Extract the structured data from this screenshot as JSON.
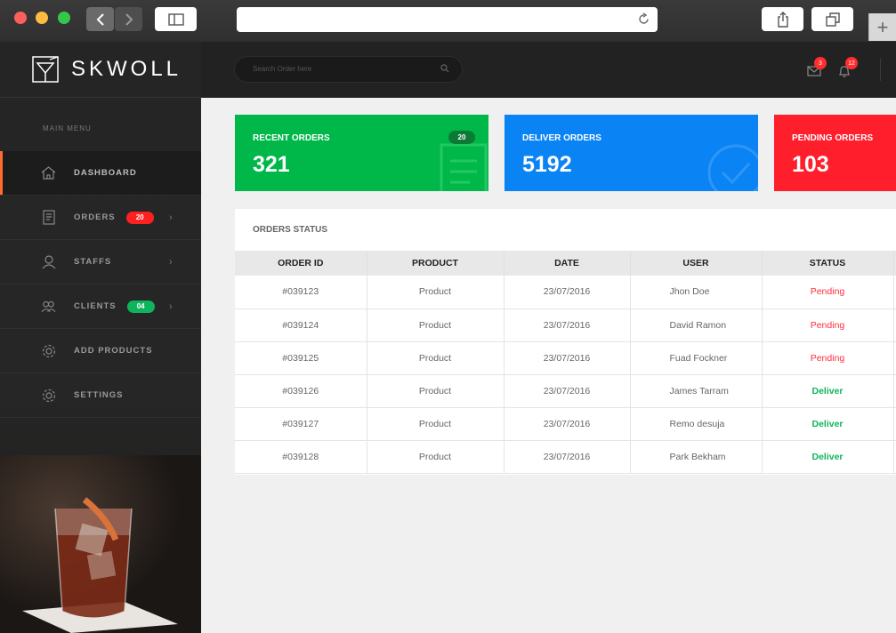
{
  "browser": {
    "url": ""
  },
  "brand": {
    "name": "SKWOLL"
  },
  "sidebar": {
    "menu_title": "MAIN MENU",
    "items": [
      {
        "label": "DASHBOARD",
        "icon": "home-icon",
        "badge": null
      },
      {
        "label": "ORDERS",
        "icon": "orders-icon",
        "badge": "20",
        "badge_color": "#ff2020"
      },
      {
        "label": "STAFFS",
        "icon": "user-icon",
        "badge": null
      },
      {
        "label": "CLIENTS",
        "icon": "clients-icon",
        "badge": "04",
        "badge_color": "#0eb45c"
      },
      {
        "label": "ADD PRODUCTS",
        "icon": "gear-icon",
        "badge": null
      },
      {
        "label": "SETTINGS",
        "icon": "gear-icon",
        "badge": null
      }
    ]
  },
  "topbar": {
    "search_placeholder": "Search Order here",
    "mail_count": "3",
    "bell_count": "12"
  },
  "cards": [
    {
      "label": "RECENT ORDERS",
      "value": "321",
      "badge": "20",
      "color": "#00b74a"
    },
    {
      "label": "DELIVER ORDERS",
      "value": "5192",
      "color": "#0a84f4"
    },
    {
      "label": "PENDING ORDERS",
      "value": "103",
      "color": "#ff1e2b"
    }
  ],
  "orders": {
    "title": "ORDERS STATUS",
    "columns": [
      "ORDER ID",
      "PRODUCT",
      "DATE",
      "USER",
      "STATUS"
    ],
    "rows": [
      {
        "id": "#039123",
        "product": "Product",
        "date": "23/07/2016",
        "user": "Jhon Doe",
        "status": "Pending"
      },
      {
        "id": "#039124",
        "product": "Product",
        "date": "23/07/2016",
        "user": "David Ramon",
        "status": "Pending"
      },
      {
        "id": "#039125",
        "product": "Product",
        "date": "23/07/2016",
        "user": "Fuad Fockner",
        "status": "Pending"
      },
      {
        "id": "#039126",
        "product": "Product",
        "date": "23/07/2016",
        "user": "James Tarram",
        "status": "Deliver"
      },
      {
        "id": "#039127",
        "product": "Product",
        "date": "23/07/2016",
        "user": "Remo desuja",
        "status": "Deliver"
      },
      {
        "id": "#039128",
        "product": "Product",
        "date": "23/07/2016",
        "user": "Park Bekham",
        "status": "Deliver"
      }
    ]
  },
  "colors": {
    "accent": "#ff6d2c",
    "pending": "#ff2e3a",
    "deliver": "#0eb45c"
  }
}
